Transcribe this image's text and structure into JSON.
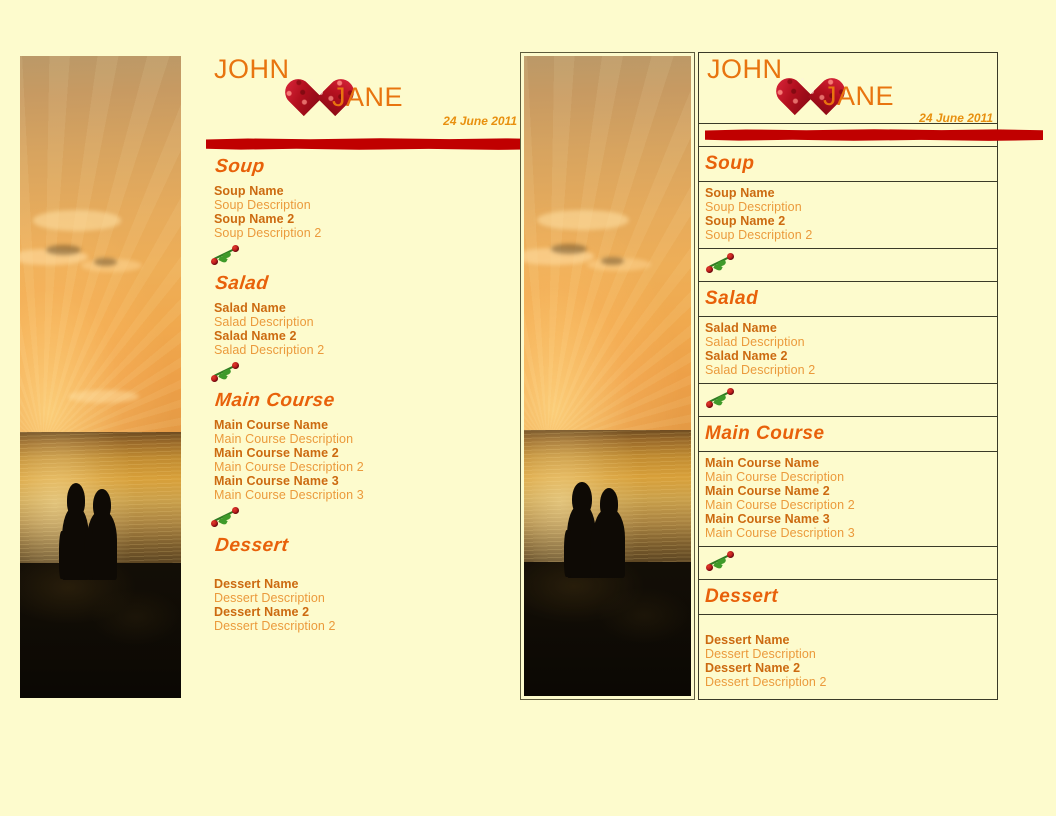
{
  "document": {
    "type": "wedding-menu-template",
    "background_color": "#fdfbcd",
    "accent_color": "#e8610a",
    "name_color": "#cc6a10",
    "description_color": "#eb9a3c",
    "rule_color": "#c00000",
    "border_color": "#3a3a28"
  },
  "header": {
    "name_first": "JOHN",
    "name_second": "JANE",
    "date": "24 June 2011",
    "heart_icon": "rose-petal-heart-icon",
    "divider_icon": "red-brush-rule"
  },
  "photo": {
    "alt": "sunset beach with silhouetted couple",
    "icon": "beach-sunset-photo"
  },
  "rose_divider_icon": "roses-on-stem-icon",
  "menu": {
    "sections": [
      {
        "title": "Soup",
        "items": [
          {
            "name": "Soup Name",
            "description": "Soup Description"
          },
          {
            "name": "Soup Name 2",
            "description": "Soup Description 2"
          }
        ]
      },
      {
        "title": "Salad",
        "items": [
          {
            "name": "Salad Name",
            "description": "Salad Description"
          },
          {
            "name": "Salad Name 2",
            "description": "Salad Description 2"
          }
        ]
      },
      {
        "title": "Main Course",
        "items": [
          {
            "name": "Main Course Name",
            "description": "Main Course Description"
          },
          {
            "name": "Main Course Name 2",
            "description": "Main Course Description 2"
          },
          {
            "name": "Main Course Name 3",
            "description": "Main Course Description 3"
          }
        ]
      },
      {
        "title": "Dessert",
        "items": [
          {
            "name": "Dessert Name",
            "description": "Dessert Description"
          },
          {
            "name": "Dessert Name 2",
            "description": "Dessert Description 2"
          }
        ]
      }
    ]
  }
}
